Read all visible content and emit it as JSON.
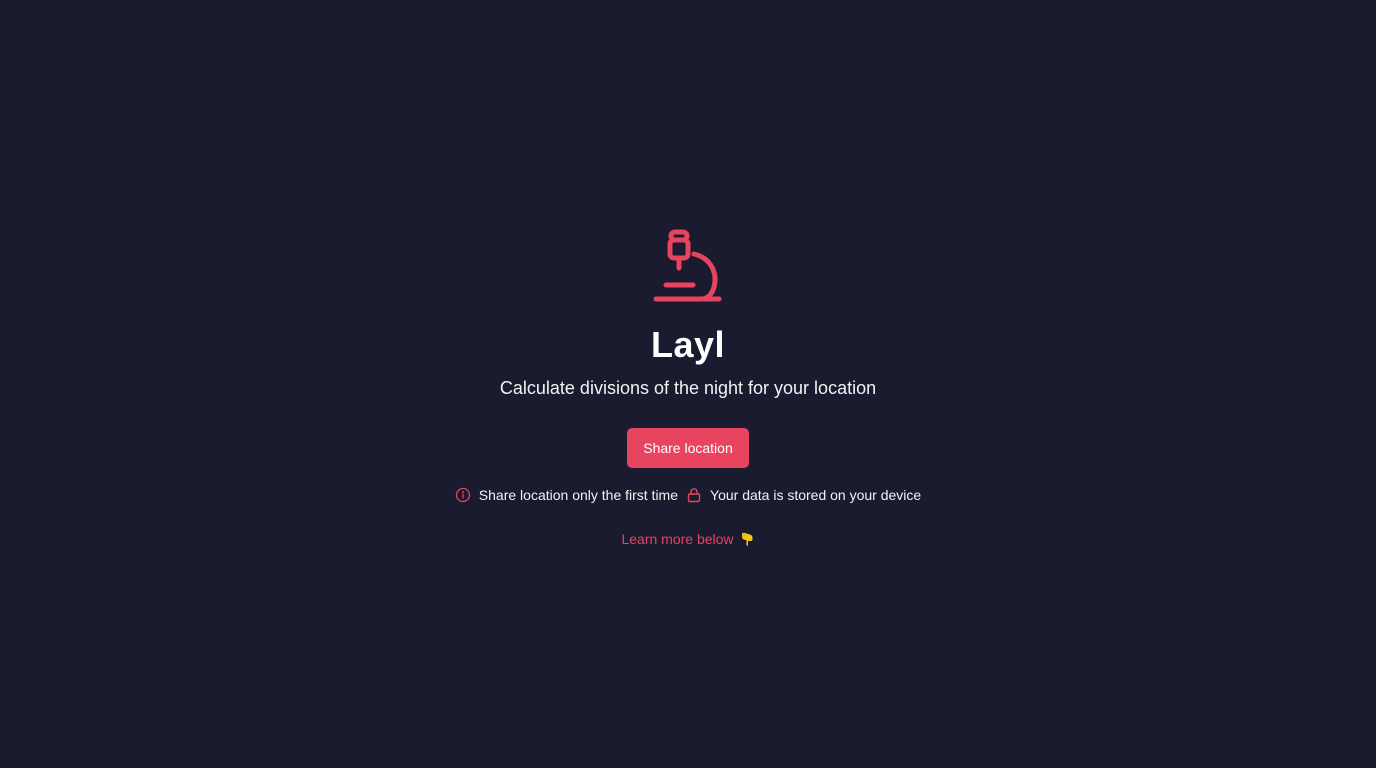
{
  "app": {
    "title": "Layl",
    "subtitle": "Calculate divisions of the night for your location",
    "logo_icon": "microscope-icon"
  },
  "actions": {
    "share_label": "Share location"
  },
  "notes": [
    {
      "icon": "info-icon",
      "text": "Share location only the first time"
    },
    {
      "icon": "lock-icon",
      "text": "Your data is stored on your device"
    }
  ],
  "learn_more": {
    "label": "Learn more below",
    "icon": "pointing-down-icon"
  },
  "colors": {
    "background": "#1a1b2e",
    "accent": "#e8435f",
    "text": "#ffffff"
  }
}
